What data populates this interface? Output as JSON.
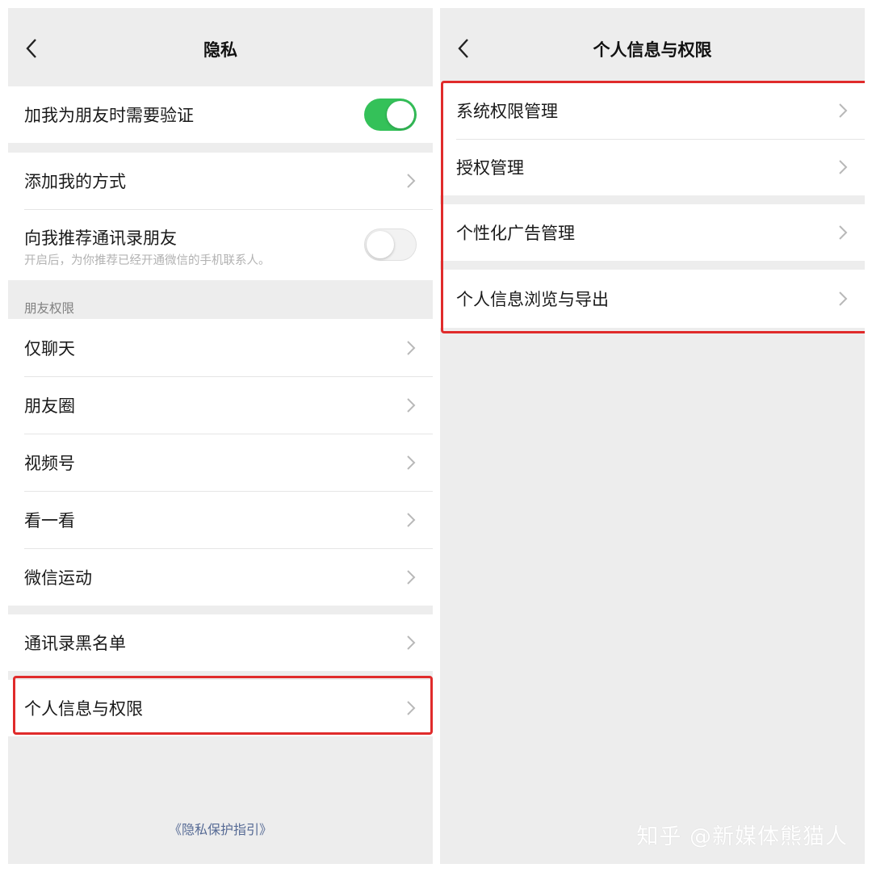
{
  "left": {
    "title": "隐私",
    "cells": {
      "verify": {
        "label": "加我为朋友时需要验证",
        "toggle": "on"
      },
      "add_methods": {
        "label": "添加我的方式"
      },
      "recommend": {
        "label": "向我推荐通讯录朋友",
        "sub": "开启后，为你推荐已经开通微信的手机联系人。",
        "toggle": "off"
      }
    },
    "section_friend_perms": "朋友权限",
    "friend_items": [
      "仅聊天",
      "朋友圈",
      "视频号",
      "看一看",
      "微信运动"
    ],
    "blacklist": "通讯录黑名单",
    "personal_info": "个人信息与权限",
    "guide_link": "《隐私保护指引》"
  },
  "right": {
    "title": "个人信息与权限",
    "items": [
      "系统权限管理",
      "授权管理",
      "个性化广告管理",
      "个人信息浏览与导出"
    ]
  },
  "watermark": "知乎 @新媒体熊猫人",
  "colors": {
    "toggle_on": "#34c159",
    "highlight": "#e02b2b",
    "link": "#576b95"
  },
  "icons": {
    "back": "chevron-left-icon",
    "row": "chevron-right-icon"
  }
}
